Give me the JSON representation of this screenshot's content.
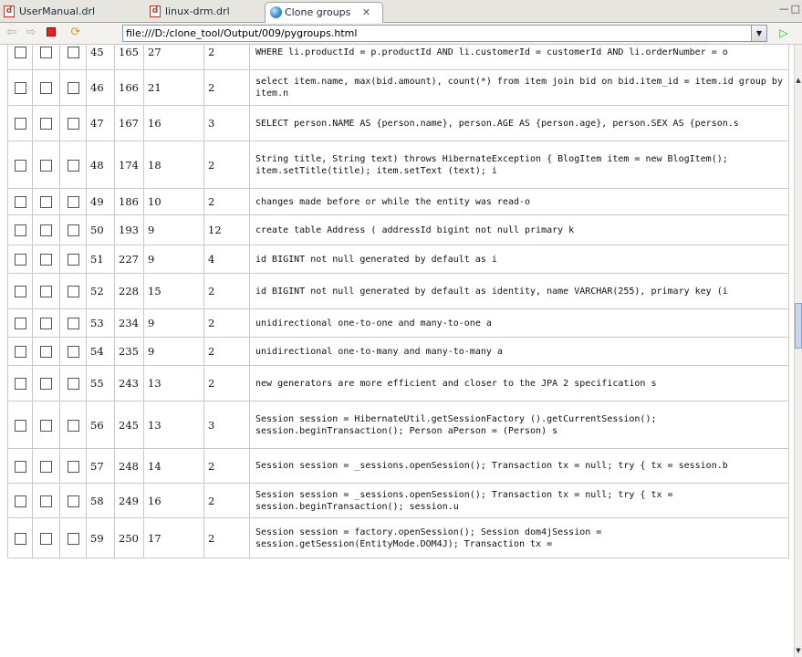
{
  "tabs": [
    {
      "label": "UserManual.drl",
      "icon": "drl-file-icon"
    },
    {
      "label": "linux-drm.drl",
      "icon": "drl-file-icon"
    },
    {
      "label": "Clone groups",
      "icon": "globe-icon",
      "close": "✕"
    }
  ],
  "toolbar": {
    "url": "file:///D:/clone_tool/Output/009/pygroups.html",
    "back_icon": "back-arrow-icon",
    "forward_icon": "forward-arrow-icon",
    "stop_icon": "stop-icon",
    "refresh_icon": "refresh-icon",
    "go_icon": "go-icon"
  },
  "rows": [
    {
      "id": "45",
      "start": "165",
      "len": "27",
      "count": "2",
      "text": "WHERE li.productId = p.productId AND li.customerId = customerId AND li.orderNumber = o"
    },
    {
      "id": "46",
      "start": "166",
      "len": "21",
      "count": "2",
      "text": "select item.name, max(bid.amount), count(*) from item join bid on bid.item_id = item.id group by item.n"
    },
    {
      "id": "47",
      "start": "167",
      "len": "16",
      "count": "3",
      "text": "SELECT person.NAME AS {person.name}, person.AGE AS {person.age}, person.SEX AS {person.s"
    },
    {
      "id": "48",
      "start": "174",
      "len": "18",
      "count": "2",
      "text": "String title, String text) throws HibernateException { BlogItem item = new BlogItem(); item.setTitle(title); item.setText (text); i"
    },
    {
      "id": "49",
      "start": "186",
      "len": "10",
      "count": "2",
      "text": "changes made before or while the entity was read-o"
    },
    {
      "id": "50",
      "start": "193",
      "len": "9",
      "count": "12",
      "text": "create table Address ( addressId bigint not null primary k"
    },
    {
      "id": "51",
      "start": "227",
      "len": "9",
      "count": "4",
      "text": "id BIGINT not null generated by default as i"
    },
    {
      "id": "52",
      "start": "228",
      "len": "15",
      "count": "2",
      "text": "id BIGINT not null generated by default as identity, name VARCHAR(255), primary key (i"
    },
    {
      "id": "53",
      "start": "234",
      "len": "9",
      "count": "2",
      "text": "unidirectional one-to-one and many-to-one a"
    },
    {
      "id": "54",
      "start": "235",
      "len": "9",
      "count": "2",
      "text": "unidirectional one-to-many and many-to-many a"
    },
    {
      "id": "55",
      "start": "243",
      "len": "13",
      "count": "2",
      "text": "new generators are more efficient and closer to the JPA 2 specification s"
    },
    {
      "id": "56",
      "start": "245",
      "len": "13",
      "count": "3",
      "text": "Session session = HibernateUtil.getSessionFactory ().getCurrentSession(); session.beginTransaction(); Person aPerson = (Person) s"
    },
    {
      "id": "57",
      "start": "248",
      "len": "14",
      "count": "2",
      "text": "Session session = _sessions.openSession(); Transaction tx = null; try { tx = session.b"
    },
    {
      "id": "58",
      "start": "249",
      "len": "16",
      "count": "2",
      "text": "Session session = _sessions.openSession(); Transaction tx = null; try { tx = session.beginTransaction(); session.u"
    },
    {
      "id": "59",
      "start": "250",
      "len": "17",
      "count": "2",
      "text": "Session session = factory.openSession(); Session dom4jSession = session.getSession(EntityMode.DOM4J); Transaction tx ="
    }
  ]
}
